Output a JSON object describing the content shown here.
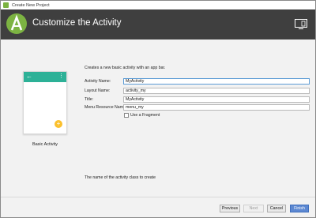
{
  "window": {
    "title": "Create New Project"
  },
  "header": {
    "title": "Customize the Activity"
  },
  "preview": {
    "template_label": "Basic Activity",
    "back_glyph": "←",
    "menu_glyph": "⋮",
    "fab_glyph": "+"
  },
  "form": {
    "description": "Creates a new basic activity with an app bar.",
    "fields": [
      {
        "label": "Activity Name:",
        "value": "MyActivity"
      },
      {
        "label": "Layout Name:",
        "value": "activity_my"
      },
      {
        "label": "Title:",
        "value": "MyActivity"
      },
      {
        "label": "Menu Resource Name:",
        "value": "menu_my"
      }
    ],
    "use_fragment": {
      "label": "Use a Fragment",
      "checked": false
    },
    "hint": "The name of the activity class to create"
  },
  "buttons": {
    "previous": "Previous",
    "next": "Next",
    "cancel": "Cancel",
    "finish": "Finish"
  },
  "colors": {
    "header_bg": "#3f3f3f",
    "app_bar": "#2db197",
    "fab": "#fbc02d",
    "primary_button": "#5c88d2",
    "android_green": "#a4c639"
  }
}
